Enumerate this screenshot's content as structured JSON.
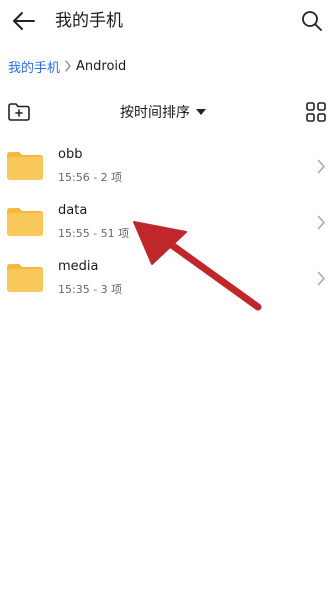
{
  "header": {
    "title": "我的手机"
  },
  "breadcrumb": {
    "root": "我的手机",
    "current": "Android"
  },
  "toolbar": {
    "sort_label": "按时间排序"
  },
  "folders": [
    {
      "name": "obb",
      "meta": "15:56 - 2 项"
    },
    {
      "name": "data",
      "meta": "15:55 - 51 项"
    },
    {
      "name": "media",
      "meta": "15:35 - 3 项"
    }
  ],
  "colors": {
    "folder": "#f8c95a",
    "folder_tab": "#f4b93c",
    "link": "#2a6fe0",
    "arrow": "#c0272d"
  },
  "icons": {
    "back": "back-arrow-icon",
    "search": "search-icon",
    "new_folder": "new-folder-icon",
    "grid_view": "grid-view-icon",
    "folder": "folder-icon",
    "chevron": "chevron-right-icon",
    "caret": "caret-down-icon"
  }
}
